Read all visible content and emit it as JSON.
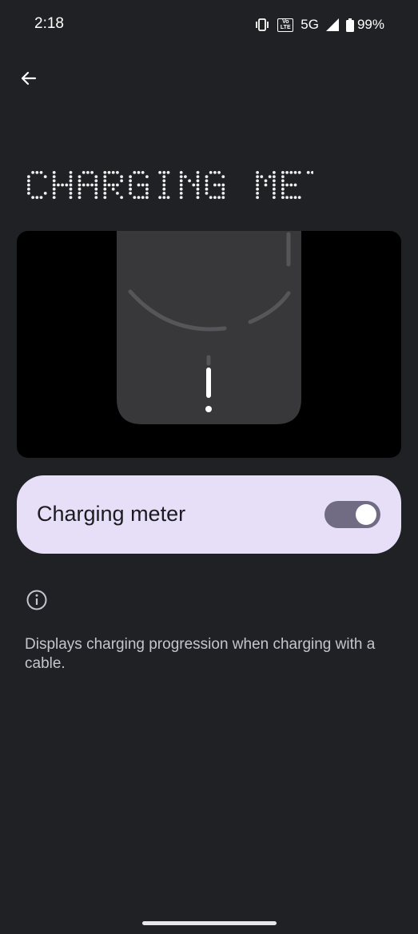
{
  "status_bar": {
    "time": "2:18",
    "network": "5G",
    "battery": "99%",
    "icons": [
      "vibrate-icon",
      "volte-icon",
      "signal-icon",
      "battery-icon"
    ],
    "volte_top": "Vo",
    "volte_bottom": "LTE"
  },
  "header": {
    "back_icon": "arrow-back-icon",
    "title": "CHARGING METER"
  },
  "preview": {
    "description_icon": "phone-charging-meter-illustration"
  },
  "setting": {
    "label": "Charging meter",
    "enabled": true
  },
  "info": {
    "icon": "info-icon",
    "text": "Displays charging progression when charging with a cable."
  },
  "colors": {
    "background": "#202124",
    "card": "#e7def8",
    "switch_track": "#726b84",
    "title_dots": "#eeeeee",
    "preview_phone": "#38383b"
  }
}
